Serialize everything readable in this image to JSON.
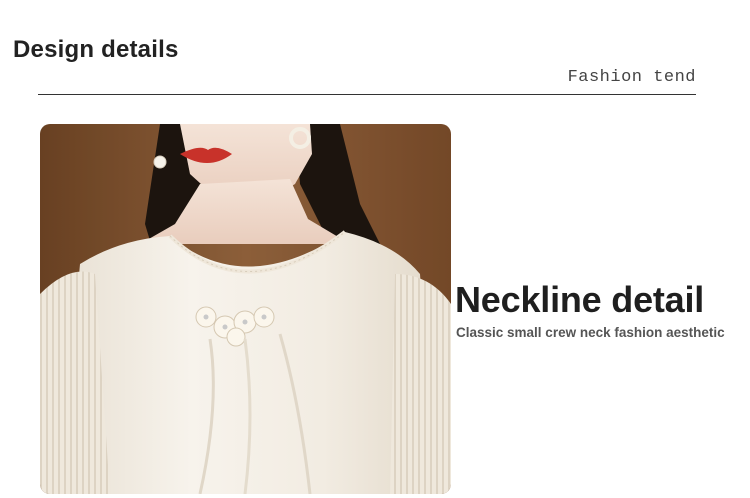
{
  "section": {
    "title": "Design details",
    "tag": "Fashion tend"
  },
  "feature": {
    "headline": "Neckline detail",
    "description": "Classic small crew neck fashion aesthetic"
  },
  "photo": {
    "alt": "Model wearing white blouse with floral pearl crew neckline"
  },
  "colors": {
    "background": "#ffffff",
    "wall": "#8a5a33",
    "blouse": "#f4efe6",
    "lips": "#c8322a",
    "skin": "#f1ddd0"
  }
}
